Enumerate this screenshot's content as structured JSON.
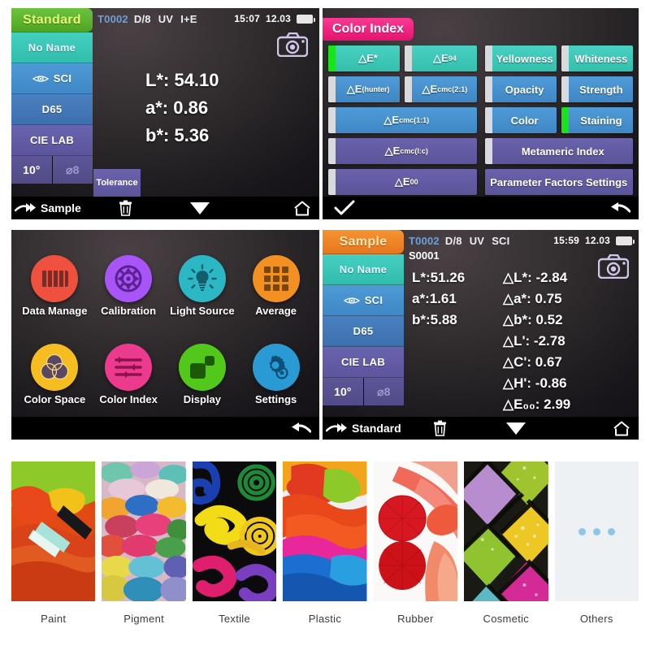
{
  "screens": {
    "standard": {
      "tab_label": "Standard",
      "status": {
        "sample_id": "T0002",
        "geometry": "D/8",
        "uv": "UV",
        "mode": "I+E",
        "time": "15:07",
        "date": "12.03"
      },
      "sidebar": [
        {
          "name": "No Name"
        },
        {
          "name": "SCI",
          "icon": "eye-icon"
        },
        {
          "name": "D65"
        },
        {
          "name": "CIE LAB"
        }
      ],
      "observer": "10°",
      "aperture": "⌀0 8",
      "aperture_text": "⌀8",
      "tolerance_label": "Tolerance",
      "readout": [
        {
          "label": "L*",
          "value": "54.10"
        },
        {
          "label": "a*",
          "value": "0.86"
        },
        {
          "label": "b*",
          "value": "5.36"
        }
      ],
      "nav": [
        {
          "name": "to-sample",
          "label": "Sample",
          "icon": "arrow-right-icon"
        },
        {
          "name": "delete",
          "label": "",
          "icon": "trash-icon"
        },
        {
          "name": "scroll-down",
          "label": "",
          "icon": "triangle-down-icon"
        },
        {
          "name": "home",
          "label": "",
          "icon": "home-icon"
        }
      ],
      "camera_icon": "camera-icon"
    },
    "color_index": {
      "tab_label": "Color Index",
      "left_column": [
        {
          "label": "△E*",
          "color": "teal",
          "selected": true,
          "half": true
        },
        {
          "label": "△E",
          "sub": "94",
          "color": "teal",
          "selected": false,
          "half": true
        },
        {
          "label": "△E",
          "sub": "(hunter)",
          "color": "blue",
          "selected": false,
          "half": true
        },
        {
          "label": "△E",
          "sub": "cmc(2:1)",
          "color": "blue",
          "selected": false,
          "half": true
        },
        {
          "label": "△E",
          "sub": "cmc(1:1)",
          "color": "blue",
          "selected": false,
          "half": false
        },
        {
          "label": "△E",
          "sub": "cmc(l:c)",
          "color": "purple",
          "selected": false,
          "half": false
        },
        {
          "label": "△E",
          "sub": "00",
          "color": "purple",
          "selected": false,
          "half": false
        }
      ],
      "right_column": [
        {
          "label": "Yellowness",
          "color": "teal",
          "selected": false,
          "half": true
        },
        {
          "label": "Whiteness",
          "color": "teal",
          "selected": false,
          "half": true
        },
        {
          "label": "Opacity",
          "color": "blue",
          "selected": false,
          "half": true
        },
        {
          "label": "Strength",
          "color": "blue",
          "selected": false,
          "half": true
        },
        {
          "label": "Color",
          "color": "blue",
          "selected": false,
          "half": true
        },
        {
          "label": "Staining",
          "color": "blue",
          "selected": true,
          "half": true
        },
        {
          "label": "Metameric Index",
          "color": "purple",
          "selected": false,
          "half": false
        },
        {
          "label": "Parameter Factors Settings",
          "color": "purple",
          "selected": false,
          "half": false,
          "nobar": true
        }
      ],
      "nav": [
        {
          "name": "confirm",
          "icon": "check-icon"
        },
        {
          "name": "back",
          "icon": "back-arrow-icon"
        }
      ]
    },
    "home": {
      "items": [
        {
          "label": "Data Manage",
          "icon": "data-manage-icon",
          "color": "#f0513f"
        },
        {
          "label": "Calibration",
          "icon": "calibration-icon",
          "color": "#a855f7"
        },
        {
          "label": "Light Source",
          "icon": "light-source-icon",
          "color": "#2bb8c4"
        },
        {
          "label": "Average",
          "icon": "average-icon",
          "color": "#f29021"
        },
        {
          "label": "Color Space",
          "icon": "color-space-icon",
          "color": "#f5bd20"
        },
        {
          "label": "Color Index",
          "icon": "color-index-icon",
          "color": "#ec3b8e"
        },
        {
          "label": "Display",
          "icon": "display-icon",
          "color": "#52c91a"
        },
        {
          "label": "Settings",
          "icon": "settings-icon",
          "color": "#2a9ad4"
        }
      ],
      "nav": [
        {
          "name": "back",
          "icon": "back-arrow-icon"
        }
      ]
    },
    "sample": {
      "tab_label": "Sample",
      "status": {
        "sample_id": "T0002",
        "geometry": "D/8",
        "uv": "UV",
        "mode": "SCI",
        "time": "15:59",
        "date": "12.03"
      },
      "sub_id": "S0001",
      "sidebar": [
        {
          "name": "No Name"
        },
        {
          "name": "SCI",
          "icon": "eye-icon"
        },
        {
          "name": "D65"
        },
        {
          "name": "CIE LAB"
        }
      ],
      "observer": "10°",
      "aperture_text": "⌀8",
      "readout_left": [
        {
          "label": "L*:",
          "value": "51.26"
        },
        {
          "label": "a*:",
          "value": "1.61"
        },
        {
          "label": "b*:",
          "value": "5.88"
        }
      ],
      "readout_right": [
        {
          "label": "△L*",
          "value": "-2.84"
        },
        {
          "label": "△a*",
          "value": "0.75"
        },
        {
          "label": "△b*",
          "value": "0.52"
        },
        {
          "label": "△L'",
          "value": "-2.78"
        },
        {
          "label": "△C'",
          "value": "0.67"
        },
        {
          "label": "△H'",
          "value": "-0.86"
        },
        {
          "label": "△E₀₀",
          "value": "2.99"
        }
      ],
      "nav": [
        {
          "name": "to-standard",
          "label": "Standard",
          "icon": "arrow-right-icon"
        },
        {
          "name": "delete",
          "label": "",
          "icon": "trash-icon"
        },
        {
          "name": "scroll-down",
          "label": "",
          "icon": "triangle-down-icon"
        },
        {
          "name": "home",
          "label": "",
          "icon": "home-icon"
        }
      ],
      "camera_icon": "camera-icon"
    }
  },
  "applications": [
    {
      "label": "Paint"
    },
    {
      "label": "Pigment"
    },
    {
      "label": "Textile"
    },
    {
      "label": "Plastic"
    },
    {
      "label": "Rubber"
    },
    {
      "label": "Cosmetic"
    },
    {
      "label": "Others"
    }
  ],
  "colors": {
    "green_tab": "#5cb83c",
    "orange_tab": "#ee8a28",
    "pink_tab": "#f0247e",
    "teal": "#33bfae",
    "blue": "#3f86c5",
    "purple": "#5a5499",
    "selected_indicator": "#19e319",
    "inactive_indicator": "#d8dade"
  }
}
